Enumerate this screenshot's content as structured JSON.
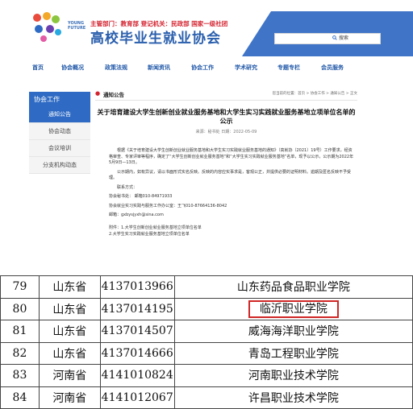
{
  "header": {
    "logo_text": "YOUNG FUTURE",
    "org_line": "主管部门：教育部   登记机关：民政部   国家一级社团",
    "site_title": "高校毕业生就业协会",
    "search_label": "搜索"
  },
  "nav": {
    "items": [
      "首页",
      "协会概况",
      "政策法规",
      "新闻资讯",
      "协会工作",
      "学术研究",
      "专题专栏",
      "会员服务"
    ]
  },
  "sidebar": {
    "title": "协会工作",
    "items": [
      "通知公告",
      "协会动态",
      "会议培训",
      "分支机构动态"
    ]
  },
  "main": {
    "tab": "通知公告",
    "breadcrumb": "您当前的位置：首页 > 协会工作 > 通知公告 > 正文",
    "title": "关于培育建设大学生创新创业就业服务基地和大学生实习实践就业服务基地立项单位名单的公示",
    "meta": "来源：秘书处    日期：2022-05-09",
    "paragraphs": [
      "根据《关于培育建设大学生创新创业就业服务基地和大学生实习实践就业服务基地的通知》（高就协〔2021〕19号）工作要求，经资格审查、专家评审等程序，确定了“大学生创新创业就业服务基地”和“大学生实习实践就业服务基地”名单，现予以公示，公示期为2022年5月9日—13日。",
      "公示期内，如有异议，请以书面形式实名反映。反映的内容应实事求是，客观公正，并提供必要的证明材料。逾期及匿名反映不予受理。",
      "联系方式：",
      "协会秘书处：    邮箱010-84971933",
      "协会就业实习实践与服务工作办公室：王飞010-87664136-8042",
      "邮箱：gxbysjyxh@sina.com",
      "附件：1.大学生创新创业就业服务基地立项单位名单",
      "2.大学生实习实践就业服务基地立项单位名单"
    ]
  },
  "table": {
    "rows": [
      {
        "no": "79",
        "province": "山东省",
        "code": "4137013966",
        "name": "山东药品食品职业学院"
      },
      {
        "no": "80",
        "province": "山东省",
        "code": "4137014195",
        "name": "临沂职业学院"
      },
      {
        "no": "81",
        "province": "山东省",
        "code": "4137014507",
        "name": "威海海洋职业学院"
      },
      {
        "no": "82",
        "province": "山东省",
        "code": "4137014666",
        "name": "青岛工程职业学院"
      },
      {
        "no": "83",
        "province": "河南省",
        "code": "4141010824",
        "name": "河南职业技术学院"
      },
      {
        "no": "84",
        "province": "河南省",
        "code": "4141012067",
        "name": "许昌职业技术学院"
      }
    ]
  },
  "colors": {
    "brand_blue": "#2f6bc4",
    "accent_red": "#d3232f",
    "highlight_border": "#d02525"
  }
}
